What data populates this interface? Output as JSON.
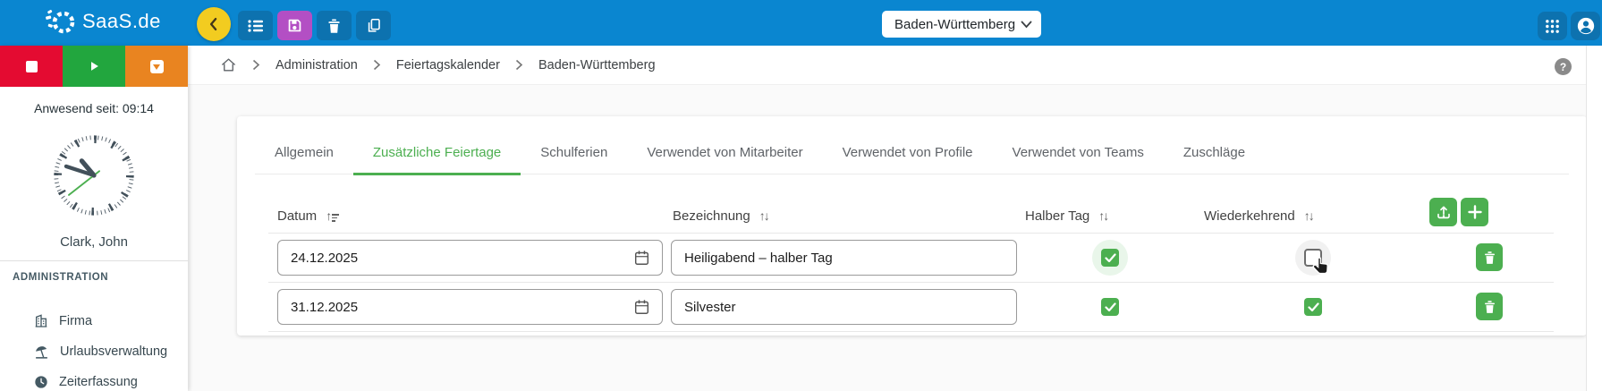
{
  "header": {
    "logo_text": "SaaS.de",
    "region_select": {
      "value": "Baden-Württemberg"
    },
    "toolbar": [
      {
        "icon": "view-list-icon"
      },
      {
        "icon": "save-icon"
      },
      {
        "icon": "trash-icon"
      },
      {
        "icon": "copy-icon"
      }
    ],
    "right_icons": [
      {
        "icon": "apps-grid-icon"
      },
      {
        "icon": "account-icon"
      }
    ]
  },
  "breadcrumb": {
    "items": [
      "Administration",
      "Feiertagskalender",
      "Baden-Württemberg"
    ]
  },
  "help": {
    "glyph": "?"
  },
  "sidebar": {
    "presence_label": "Anwesend seit: 09:14",
    "user_name": "Clark, John",
    "section_title": "ADMINISTRATION",
    "items": [
      {
        "label": "Firma",
        "icon": "building-icon"
      },
      {
        "label": "Urlaubsverwaltung",
        "icon": "beach-umbrella-icon"
      },
      {
        "label": "Zeiterfassung",
        "icon": "clock-icon"
      }
    ]
  },
  "tabs": [
    {
      "label": "Allgemein",
      "active": false
    },
    {
      "label": "Zusätzliche Feiertage",
      "active": true
    },
    {
      "label": "Schulferien",
      "active": false
    },
    {
      "label": "Verwendet von Mitarbeiter",
      "active": false
    },
    {
      "label": "Verwendet von Profile",
      "active": false
    },
    {
      "label": "Verwendet von Teams",
      "active": false
    },
    {
      "label": "Zuschläge",
      "active": false
    }
  ],
  "table": {
    "columns": [
      {
        "label": "Datum",
        "sort_glyph": "↑",
        "sort_state": "ascending"
      },
      {
        "label": "Bezeichnung",
        "sort_glyph": "↑↓",
        "sort_state": "none"
      },
      {
        "label": "Halber Tag",
        "sort_glyph": "↑↓",
        "sort_state": "none"
      },
      {
        "label": "Wiederkehrend",
        "sort_glyph": "↑↓",
        "sort_state": "none"
      }
    ],
    "rows": [
      {
        "date": "24.12.2025",
        "name": "Heiligabend – halber Tag",
        "half_day": true,
        "recurring": false
      },
      {
        "date": "31.12.2025",
        "name": "Silvester",
        "half_day": true,
        "recurring": true
      }
    ]
  },
  "colors": {
    "accent_green": "#4caf50",
    "header_blue": "#0a86d0",
    "toolbar_blue": "#0d72af",
    "save_purple": "#b34fc4",
    "collapse_yellow": "#f2cc20",
    "stop_red": "#e40b31",
    "play_green": "#22a63e",
    "pause_orange": "#e98420"
  }
}
